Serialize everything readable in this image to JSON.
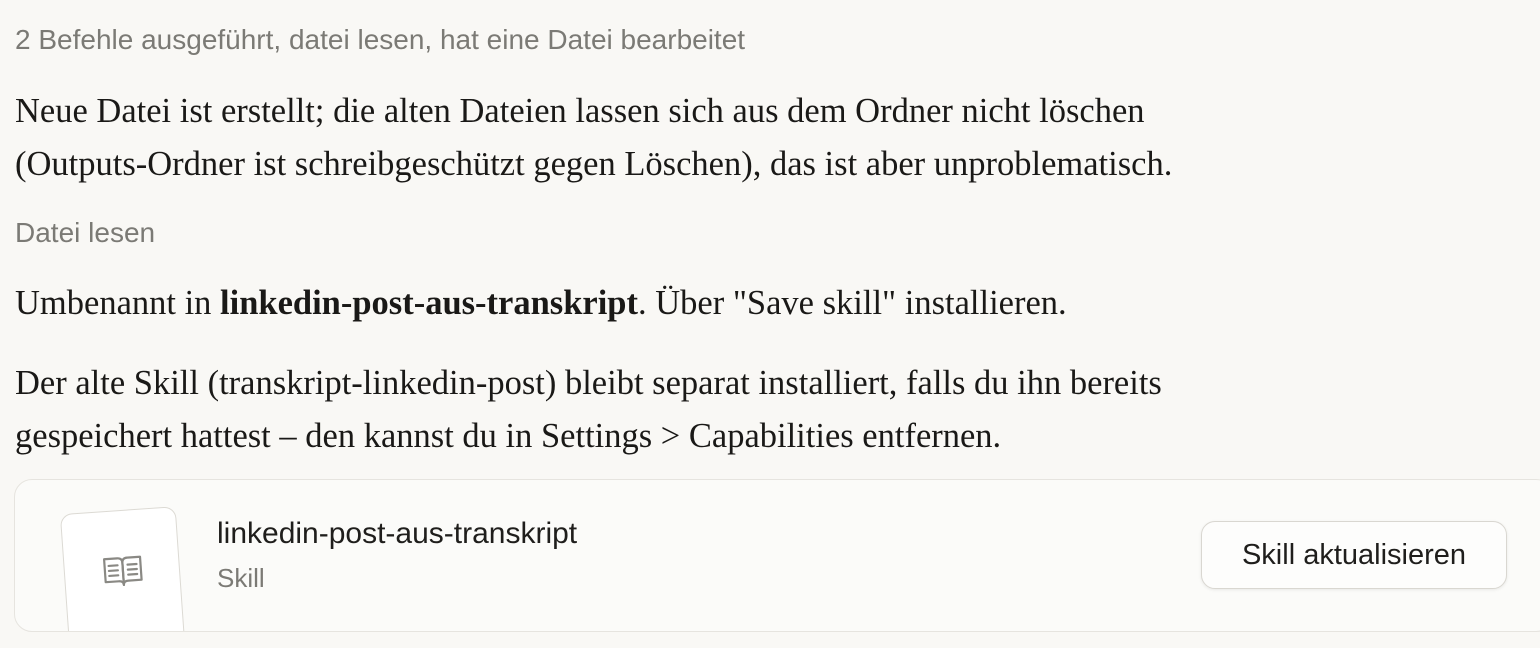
{
  "tool_summary": "2 Befehle ausgeführt, datei lesen, hat eine Datei bearbeitet",
  "message_1": {
    "line_1": "Neue Datei ist erstellt; die alten Dateien lassen sich aus dem Ordner nicht löschen",
    "line_2": "(Outputs-Ordner ist schreibgeschützt gegen Löschen), das ist aber unproblematisch."
  },
  "tool_label": "Datei lesen",
  "message_2": {
    "prefix": "Umbenannt in ",
    "bold": "linkedin-post-aus-transkript",
    "suffix": ". Über \"Save skill\" installieren."
  },
  "message_3": {
    "line_1": "Der alte Skill (transkript-linkedin-post) bleibt separat installiert, falls du ihn bereits",
    "line_2": "gespeichert hattest – den kannst du in Settings > Capabilities entfernen."
  },
  "skill_card": {
    "name": "linkedin-post-aus-transkript",
    "type": "Skill",
    "icon": "book-icon",
    "button_label": "Skill aktualisieren"
  }
}
